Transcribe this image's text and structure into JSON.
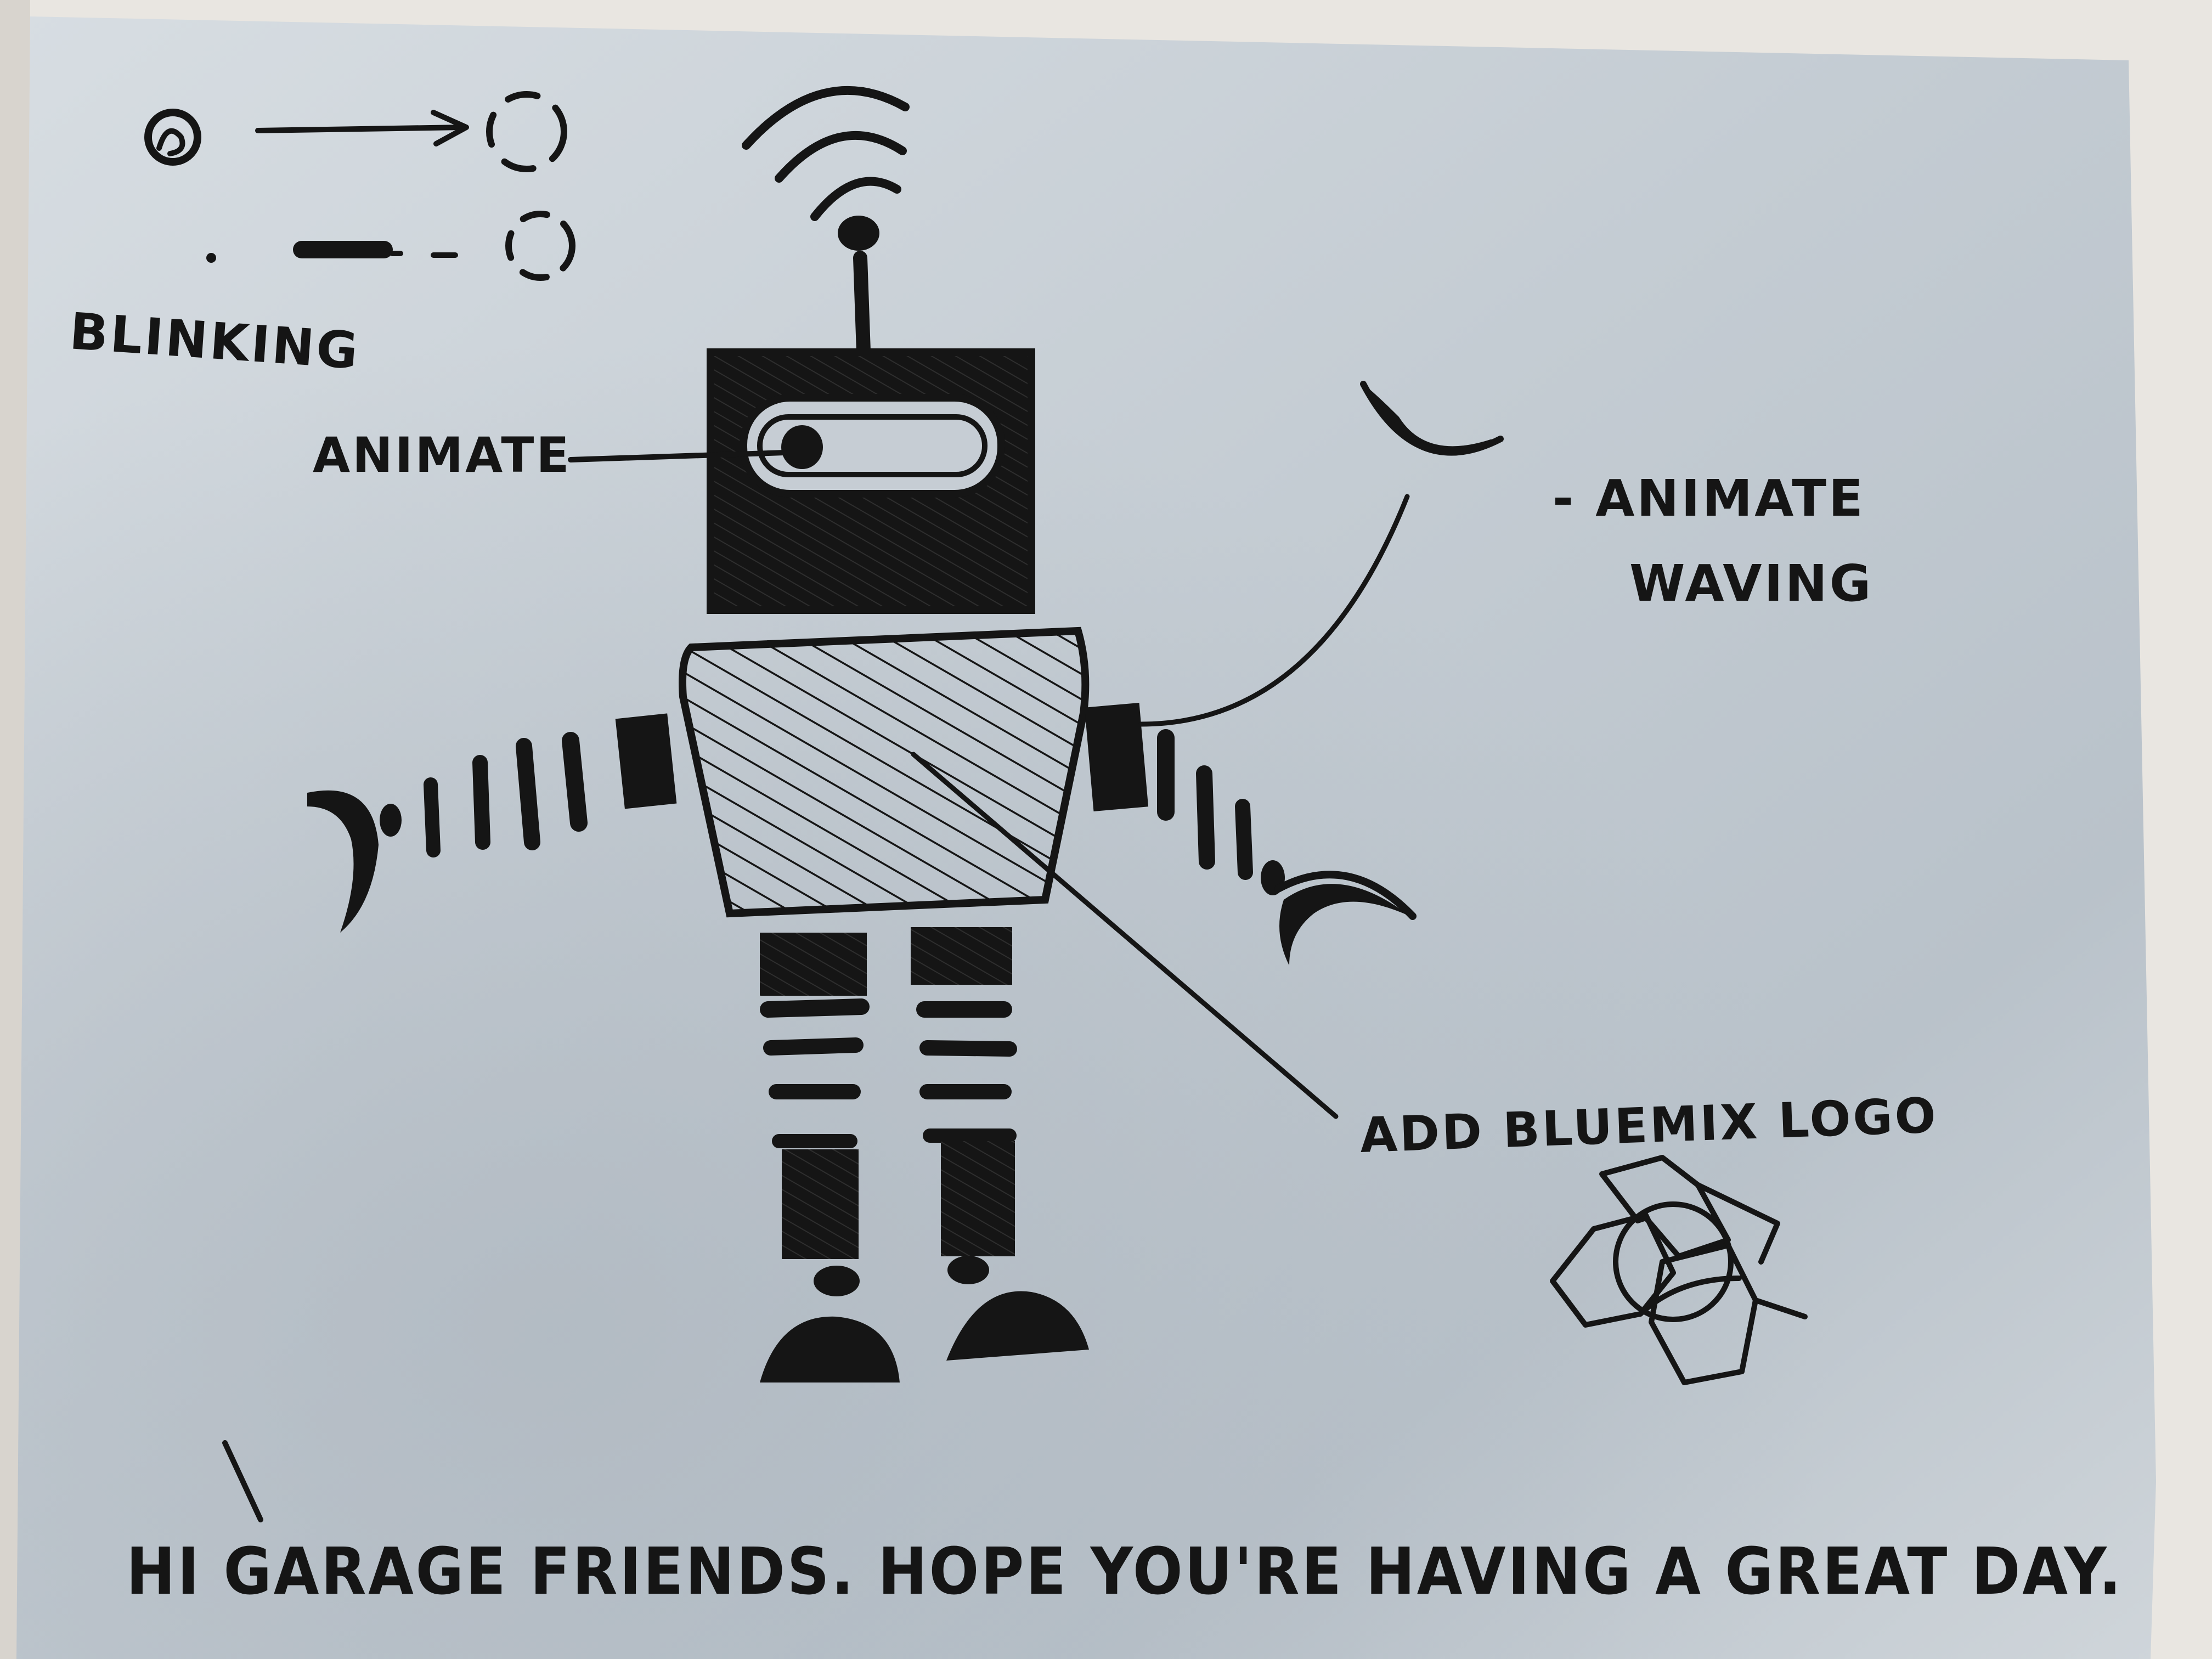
{
  "sketch": {
    "labels": {
      "blinking": "BLINKING",
      "animate_eye": "ANIMATE",
      "animate_waving_line1": "- ANIMATE",
      "animate_waving_line2": "WAVING",
      "add_logo": "ADD BLUEMIX LOGO",
      "message": "HI GARAGE FRIENDS. HOPE YOU'RE HAVING A GREAT DAY."
    },
    "colors": {
      "ink": "#151515",
      "paper": "#c9d1d9",
      "background": "#e9e6e1"
    },
    "icons": {
      "wifi": "wifi-signal-icon",
      "logo": "bluemix-logo-icon"
    }
  }
}
